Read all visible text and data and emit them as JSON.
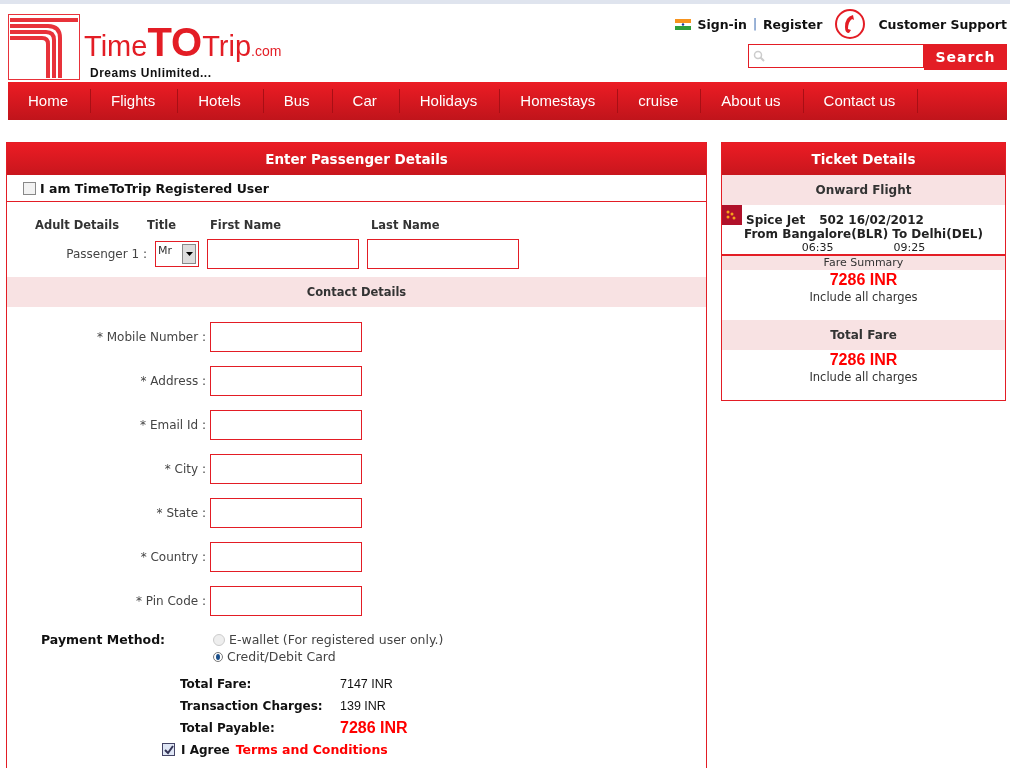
{
  "logo": {
    "brand_parts": [
      "Time",
      "TO",
      "Trip"
    ],
    "domain": ".com",
    "tagline": "Dreams Unlimited..."
  },
  "top_links": {
    "sign_in": "Sign-in",
    "separator": "|",
    "register": "Register",
    "support": "Customer Support"
  },
  "search": {
    "button": "Search"
  },
  "nav": [
    {
      "label": "Home"
    },
    {
      "label": "Flights"
    },
    {
      "label": "Hotels"
    },
    {
      "label": "Bus"
    },
    {
      "label": "Car"
    },
    {
      "label": "Holidays"
    },
    {
      "label": "Homestays"
    },
    {
      "label": "cruise"
    },
    {
      "label": "About us"
    },
    {
      "label": "Contact us"
    }
  ],
  "passenger_panel": {
    "title": "Enter Passenger Details",
    "registered_user": {
      "label": "I am TimeToTrip Registered User",
      "checked": false
    },
    "columns": [
      "Adult Details",
      "Title",
      "First Name",
      "Last Name"
    ],
    "passenger": {
      "label": "Passenger 1 :",
      "title": "Mr"
    },
    "contact_title": "Contact Details",
    "contact_fields": [
      {
        "label": "* Mobile Number :"
      },
      {
        "label": "* Address :"
      },
      {
        "label": "* Email Id :"
      },
      {
        "label": "* City :"
      },
      {
        "label": "* State :"
      },
      {
        "label": "* Country :"
      },
      {
        "label": "* Pin Code :"
      }
    ],
    "payment_label": "Payment Method:",
    "payment_options": [
      {
        "label": "E-wallet (For registered user only.)",
        "selected": false,
        "disabled": true
      },
      {
        "label": "Credit/Debit Card",
        "selected": true,
        "disabled": false
      }
    ],
    "totals": [
      {
        "label": "Total Fare:",
        "value": "7147 INR",
        "kind": "plain"
      },
      {
        "label": "Transaction Charges:",
        "value": "139 INR",
        "kind": "plain"
      },
      {
        "label": "Total Payable:",
        "value": "7286 INR",
        "kind": "highlight"
      }
    ],
    "agree": {
      "checked": true,
      "text": "I Agree",
      "link": "Terms and Conditions"
    }
  },
  "ticket_panel": {
    "title": "Ticket Details",
    "onward_title": "Onward Flight",
    "airline": "Spice Jet",
    "flight": "502 16/02/2012",
    "route": "From Bangalore(BLR) To Delhi(DEL)",
    "departure": "06:35",
    "arrival": "09:25",
    "fare_summary_title": "Fare Summary",
    "fare_amount": "7286 INR",
    "fare_note": "Include all charges",
    "total_title": "Total Fare",
    "total_amount": "7286 INR",
    "total_note": "Include all charges"
  }
}
